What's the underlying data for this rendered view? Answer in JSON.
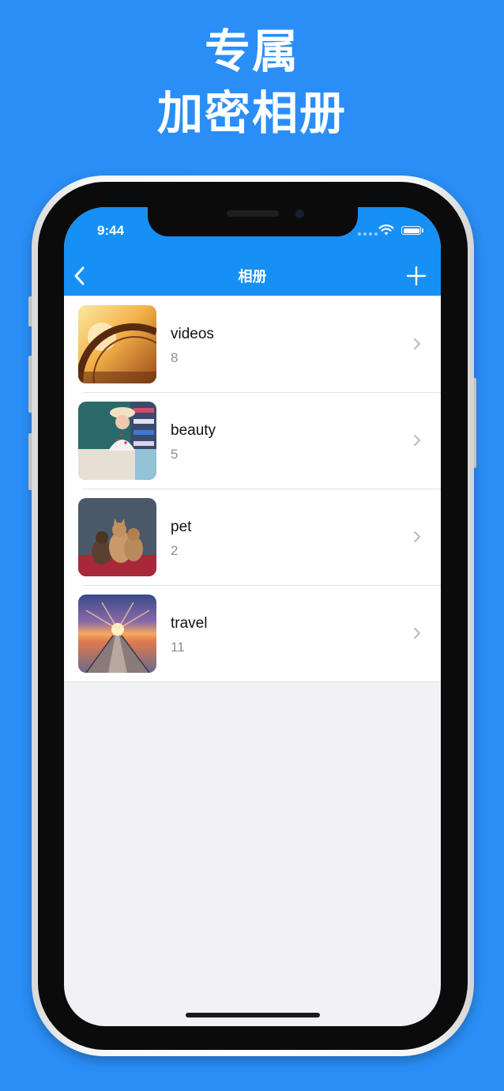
{
  "promo": {
    "line1": "专属",
    "line2": "加密相册"
  },
  "status_bar": {
    "time": "9:44"
  },
  "nav": {
    "back_icon": "chevron-left-icon",
    "title": "相册",
    "add_icon": "plus-icon"
  },
  "albums": [
    {
      "name": "videos",
      "count": "8"
    },
    {
      "name": "beauty",
      "count": "5"
    },
    {
      "name": "pet",
      "count": "2"
    },
    {
      "name": "travel",
      "count": "11"
    }
  ],
  "colors": {
    "background": "#2a8ef6",
    "nav_bar": "#1690f5",
    "list_background": "#ffffff",
    "screen_background": "#f1f1f6",
    "secondary_text": "#8e8e93"
  }
}
